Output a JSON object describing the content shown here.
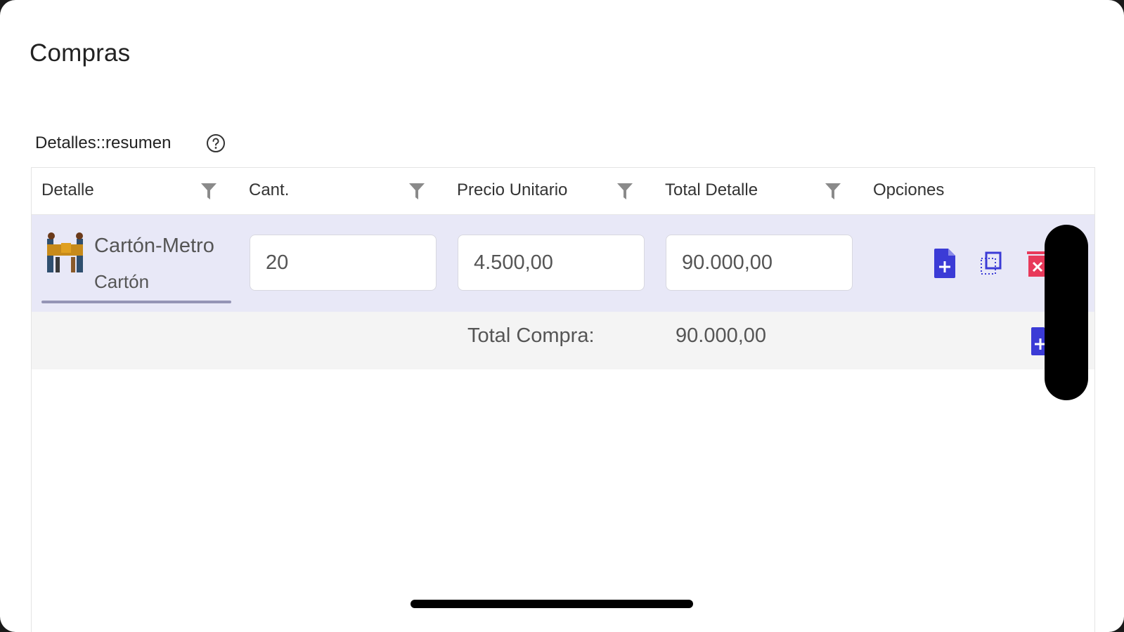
{
  "page": {
    "title": "Compras",
    "section_label": "Detalles::resumen"
  },
  "table": {
    "columns": [
      "Detalle",
      "Cant.",
      "Precio Unitario",
      "Total Detalle",
      "Opciones"
    ],
    "rows": [
      {
        "product_name": "Cartón-Metro",
        "category": "Cartón",
        "quantity": "20",
        "unit_price": "4.500,00",
        "total": "90.000,00",
        "actions": [
          "edit-document-icon",
          "duplicate-icon",
          "delete-icon"
        ]
      }
    ],
    "footer": {
      "total_label": "Total Compra:",
      "total_value": "90.000,00"
    }
  },
  "colors": {
    "accent": "#3b3bd6",
    "danger": "#e8395a",
    "selected_row": "#e8e8f7",
    "footer_row": "#f4f4f4"
  }
}
